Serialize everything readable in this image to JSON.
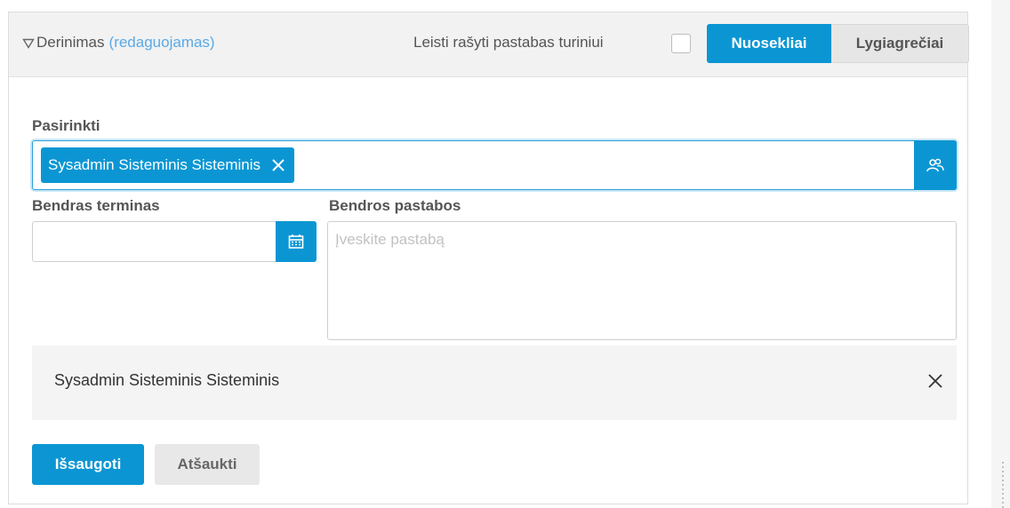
{
  "header": {
    "title": "Derinimas",
    "title_link": "(redaguojamas)",
    "allow_notes_label": "Leisti rašyti pastabas turiniui",
    "allow_notes_checked": false,
    "mode_sequential": "Nuosekliai",
    "mode_parallel": "Lygiagrečiai",
    "active_mode": "Nuosekliai"
  },
  "form": {
    "select_label": "Pasirinkti",
    "selected_chip": "Sysadmin Sisteminis Sisteminis",
    "deadline_label": "Bendras terminas",
    "deadline_value": "",
    "notes_label": "Bendros pastabos",
    "notes_placeholder": "Įveskite pastabą"
  },
  "selected_list": [
    {
      "name": "Sysadmin Sisteminis Sisteminis"
    }
  ],
  "actions": {
    "save": "Išsaugoti",
    "cancel": "Atšaukti"
  },
  "icons": {
    "collapse": "triangle-down-icon",
    "chip_remove": "close-icon",
    "user_picker": "users-icon",
    "calendar": "calendar-icon",
    "row_remove": "close-icon"
  },
  "colors": {
    "accent": "#0b96d3",
    "link": "#5aa9e6",
    "header_bg": "#f2f2f2"
  }
}
